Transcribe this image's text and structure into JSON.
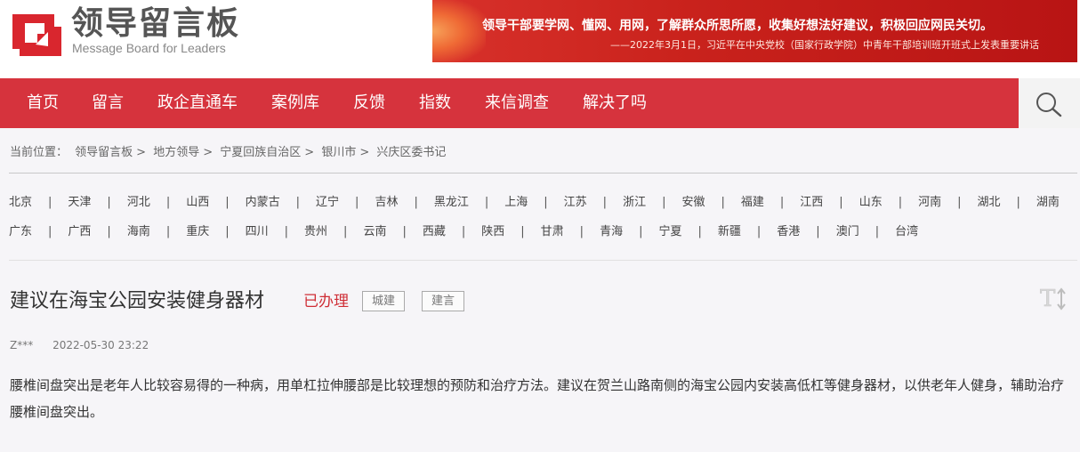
{
  "header": {
    "logo_title": "领导留言板",
    "logo_sub": "Message Board for Leaders",
    "banner_quote": "领导干部要学网、懂网、用网，了解群众所思所愿，收集好想法好建议，积极回应网民关切。",
    "banner_source": "——2022年3月1日，习近平在中央党校（国家行政学院）中青年干部培训班开班式上发表重要讲话"
  },
  "nav": {
    "items": [
      "首页",
      "留言",
      "政企直通车",
      "案例库",
      "反馈",
      "指数",
      "来信调查",
      "解决了吗"
    ],
    "search_icon": "search-icon"
  },
  "breadcrumb": {
    "prefix": "当前位置：",
    "items": [
      "领导留言板",
      "地方领导",
      "宁夏回族自治区",
      "银川市",
      "兴庆区委书记"
    ],
    "separator": ">"
  },
  "regions": {
    "row1": [
      "北京",
      "天津",
      "河北",
      "山西",
      "内蒙古",
      "辽宁",
      "吉林",
      "黑龙江",
      "上海",
      "江苏",
      "浙江",
      "安徽",
      "福建",
      "江西",
      "山东",
      "河南",
      "湖北",
      "湖南"
    ],
    "row2": [
      "广东",
      "广西",
      "海南",
      "重庆",
      "四川",
      "贵州",
      "云南",
      "西藏",
      "陕西",
      "甘肃",
      "青海",
      "宁夏",
      "新疆",
      "香港",
      "澳门",
      "台湾"
    ]
  },
  "article": {
    "title": "建议在海宝公园安装健身器材",
    "status": "已办理",
    "tags": [
      "城建",
      "建言"
    ],
    "author": "Z***",
    "date": "2022-05-30 23:22",
    "content": "腰椎间盘突出是老年人比较容易得的一种病，用单杠拉伸腰部是比较理想的预防和治疗方法。建议在贺兰山路南侧的海宝公园内安装高低杠等健身器材，以供老年人健身，辅助治疗腰椎间盘突出。"
  },
  "colors": {
    "nav_bg": "#d6333d",
    "status": "#cf2e36",
    "logo_red": "#d9262e"
  }
}
